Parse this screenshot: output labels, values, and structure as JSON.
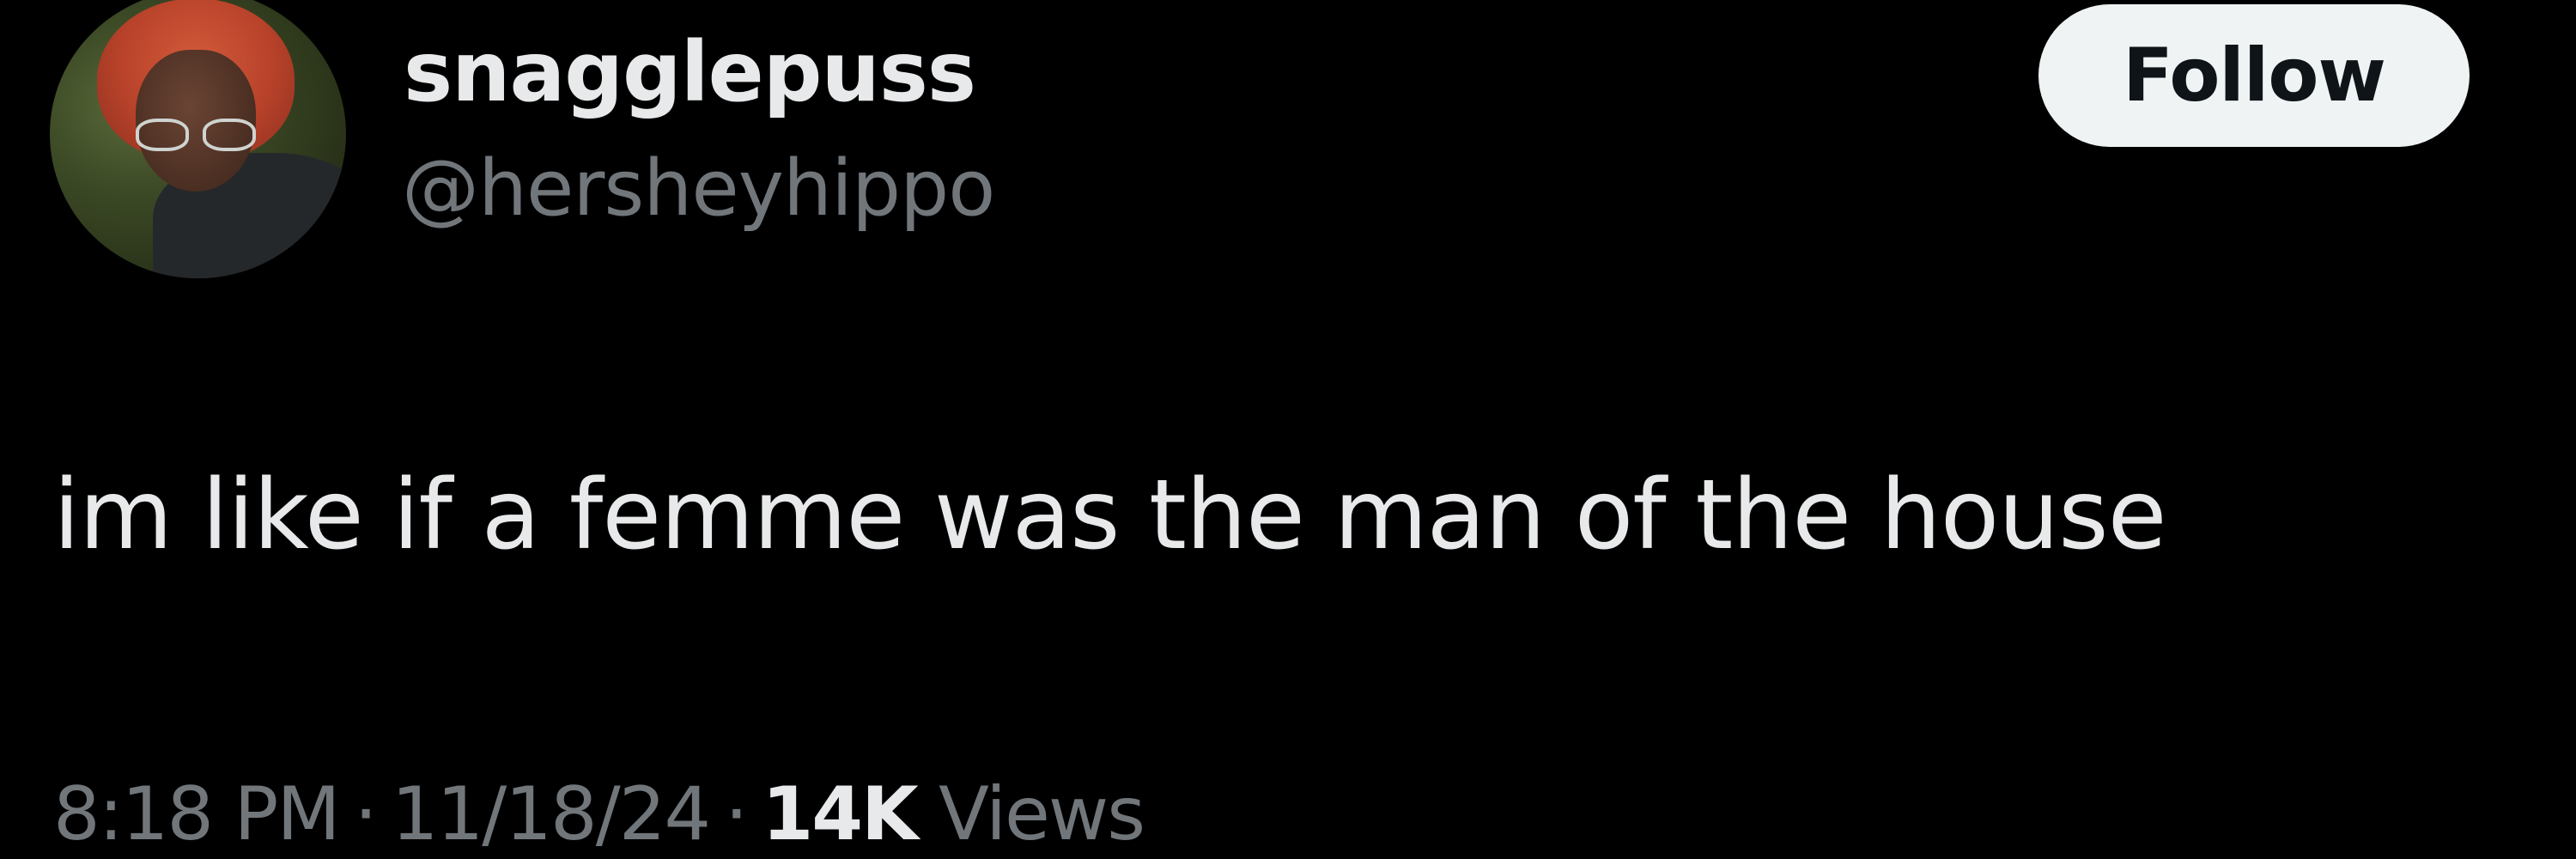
{
  "tweet": {
    "author": {
      "display_name": "snagglepuss",
      "handle": "@hersheyhippo",
      "avatar_icon": "profile-photo"
    },
    "follow_label": "Follow",
    "text": "im like if a femme was the man of the house",
    "meta": {
      "time": "8:18 PM",
      "separator": "·",
      "date": "11/18/24",
      "views_count": "14K",
      "views_label": "Views"
    }
  },
  "colors": {
    "background": "#000000",
    "primary_text": "#e7e9ea",
    "secondary_text": "#71767b",
    "follow_button_bg": "#eff3f4",
    "follow_button_text": "#0f1419"
  }
}
